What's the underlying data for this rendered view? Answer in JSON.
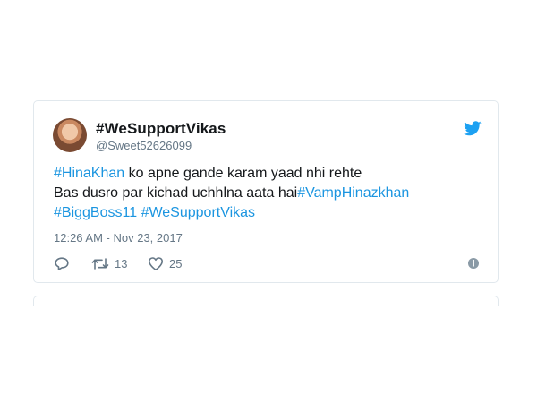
{
  "tweet": {
    "display_name": "#WeSupportVikas",
    "handle": "@Sweet52626099",
    "text_lines": [
      [
        {
          "text": "#HinaKhan",
          "hashtag": true
        },
        {
          "text": " ko apne gande karam yaad nhi rehte",
          "hashtag": false
        }
      ],
      [
        {
          "text": "Bas dusro par kichad uchhlna aata hai",
          "hashtag": false
        },
        {
          "text": "#VampHinazkhan",
          "hashtag": true
        }
      ],
      [
        {
          "text": "#BiggBoss11",
          "hashtag": true
        },
        {
          "text": " ",
          "hashtag": false
        },
        {
          "text": "#WeSupportVikas",
          "hashtag": true
        }
      ]
    ],
    "timestamp": "12:26 AM - Nov 23, 2017",
    "retweet_count": "13",
    "like_count": "25"
  },
  "icons": {
    "brand": "twitter-bird-icon",
    "reply": "reply-icon",
    "retweet": "retweet-icon",
    "like": "heart-icon",
    "info": "info-icon"
  },
  "colors": {
    "hashtag": "#1b95e0",
    "brand": "#1da1f2",
    "secondary_text": "#657786",
    "primary_text": "#14171a",
    "border": "#e1e8ed"
  }
}
